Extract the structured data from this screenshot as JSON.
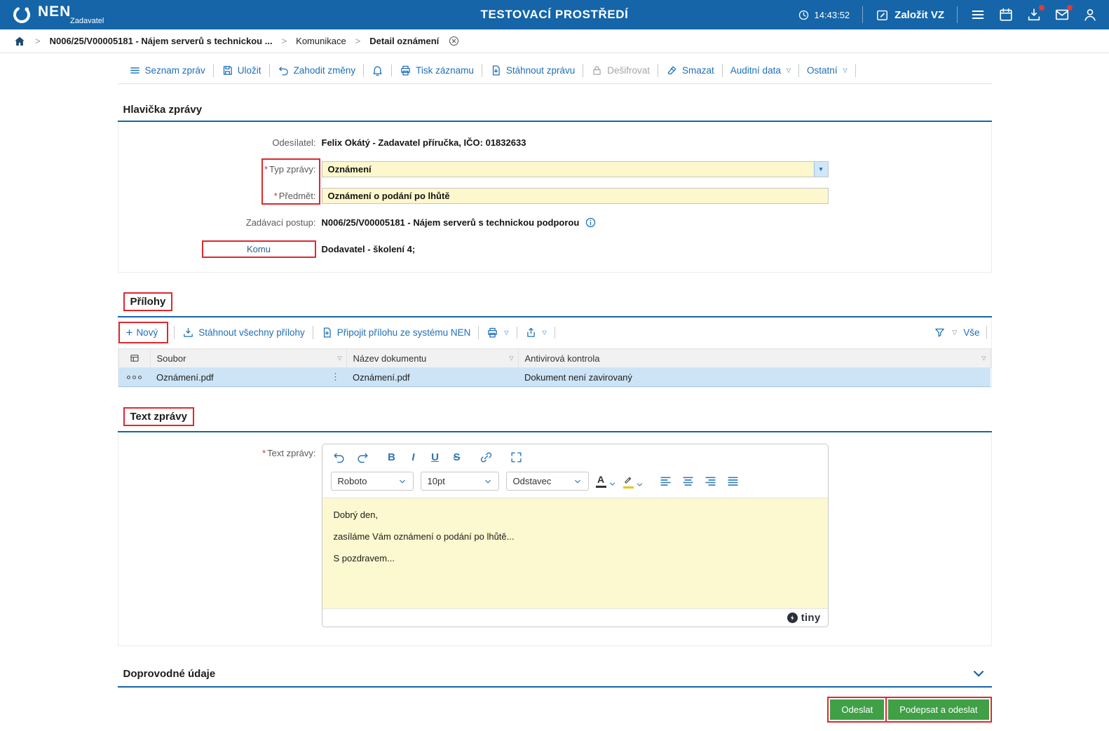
{
  "required_marker": "*",
  "colors": {
    "topbar_blue": "#1565a8",
    "accent_blue": "#1e6fb8",
    "field_yellow": "#fcf7cd",
    "selected_row_blue": "#cde4f7",
    "annotation_red": "#e0282e",
    "button_green": "#3fa046",
    "badge_red": "#e53935"
  },
  "topbar": {
    "brand": "NEN",
    "brand_sub": "Zadavatel",
    "title": "TESTOVACÍ PROSTŘEDÍ",
    "time": "14:43:52",
    "create_button": "Založit VZ"
  },
  "breadcrumb": {
    "item1": "N006/25/V00005181 - Nájem serverů s technickou ...",
    "item2": "Komunikace",
    "item3": "Detail oznámení"
  },
  "toolbar": {
    "seznam_zprav": "Seznam zpráv",
    "ulozit": "Uložit",
    "zahodit_zmeny": "Zahodit změny",
    "tisk_zaznamu": "Tisk záznamu",
    "stahnout_zpravu": "Stáhnout zprávu",
    "desifrovat": "Dešifrovat",
    "smazat": "Smazat",
    "auditni_data": "Auditní data",
    "ostatni": "Ostatní"
  },
  "hlavicka": {
    "title": "Hlavička zprávy",
    "odesilatel_label": "Odesílatel:",
    "odesilatel_value": "Felix Okátý - Zadavatel příručka, IČO: 01832633",
    "typ_zpravy_label": "Typ zprávy:",
    "typ_zpravy_value": "Oznámení",
    "predmet_label": "Předmět:",
    "predmet_value": "Oznámení o podání po lhůtě",
    "zadavaci_postup_label": "Zadávací postup:",
    "zadavaci_postup_value": "N006/25/V00005181 - Nájem serverů s technickou podporou",
    "komu_label": "Komu",
    "komu_value": "Dodavatel - školení 4;"
  },
  "prilohy": {
    "title": "Přílohy",
    "novy": "Nový",
    "stahnout_vsechny": "Stáhnout všechny přílohy",
    "pripojit": "Připojit přílohu ze systému NEN",
    "vse": "Vše",
    "col_soubor": "Soubor",
    "col_nazev": "Název dokumentu",
    "col_antivir": "Antivirová kontrola",
    "rows": [
      {
        "soubor": "Oznámení.pdf",
        "nazev": "Oznámení.pdf",
        "antivir": "Dokument není zavirovaný"
      }
    ]
  },
  "text_zpravy": {
    "title": "Text zprávy",
    "label": "Text zprávy:",
    "font_name": "Roboto",
    "font_size": "10pt",
    "block_format": "Odstavec",
    "line1": "Dobrý den,",
    "line2": "zasíláme Vám oznámení o podání po lhůtě...",
    "line3": "S pozdravem...",
    "tiny_brand": "tiny"
  },
  "doprovodne": {
    "title": "Doprovodné údaje"
  },
  "actions": {
    "odeslat": "Odeslat",
    "podepsat_a_odeslat": "Podepsat a odeslat"
  },
  "icons": {
    "caret_outline": "▽",
    "caret_filled": "▾",
    "kebab": "⋮",
    "breadcrumb_sep": ">",
    "plus": "+",
    "bold_letter": "B",
    "italic_letter": "I",
    "underline_letter": "U",
    "strike_letter": "S",
    "color_letter": "A"
  }
}
